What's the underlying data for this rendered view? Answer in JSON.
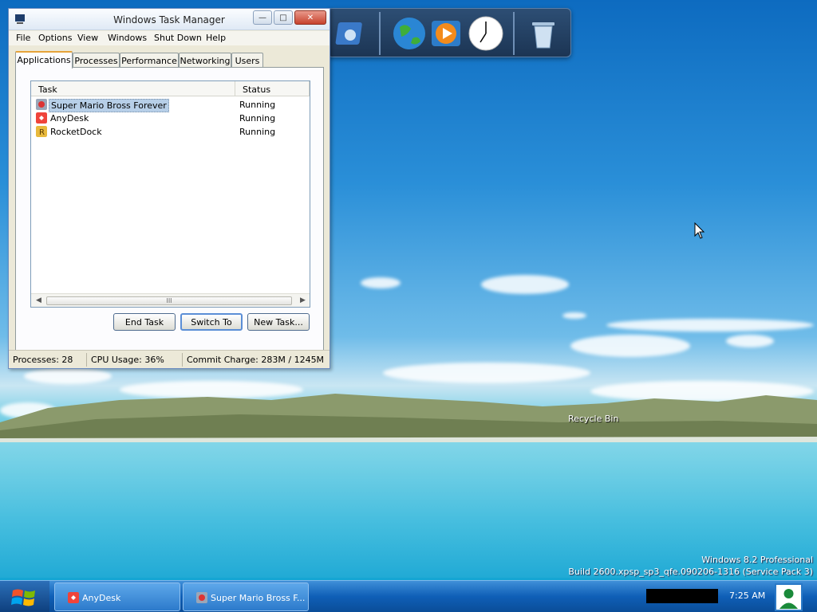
{
  "window": {
    "title": "Windows Task Manager",
    "menu": [
      "File",
      "Options",
      "View",
      "Windows",
      "Shut Down",
      "Help"
    ],
    "tabs": [
      "Applications",
      "Processes",
      "Performance",
      "Networking",
      "Users"
    ],
    "active_tab": "Applications",
    "columns": [
      "Task",
      "Status"
    ],
    "rows": [
      {
        "task": "Super Mario Bross Forever",
        "status": "Running",
        "icon": "mario-icon",
        "selected": true
      },
      {
        "task": "AnyDesk",
        "status": "Running",
        "icon": "anydesk-icon",
        "selected": false
      },
      {
        "task": "RocketDock",
        "status": "Running",
        "icon": "rocketdock-icon",
        "selected": false
      }
    ],
    "buttons": {
      "end_task": "End Task",
      "switch_to": "Switch To",
      "new_task": "New Task..."
    },
    "status": {
      "processes": "Processes: 28",
      "cpu": "CPU Usage: 36%",
      "commit": "Commit Charge: 283M / 1245M"
    },
    "scroll_thumb_glyph": "III"
  },
  "desktop": {
    "recycle_bin_label": "Recycle Bin",
    "watermark_line1": "Windows 8.2 Professional",
    "watermark_line2": "Build 2600.xpsp_sp3_qfe.090206-1316 (Service Pack 3)",
    "dock_icons": [
      "media-icon",
      "globe-icon",
      "media-player-icon",
      "clock-icon",
      "recycle-bin-icon"
    ]
  },
  "taskbar": {
    "items": [
      {
        "label": "AnyDesk",
        "icon": "anydesk-icon"
      },
      {
        "label": "Super Mario Bross F...",
        "icon": "mario-icon"
      }
    ],
    "clock": "7:25 AM"
  },
  "colors": {
    "selection": "#b7cfe8",
    "taskbar": "#1f6fc4",
    "anydesk": "#ef443b",
    "rocketdock": "#e8b93c"
  }
}
